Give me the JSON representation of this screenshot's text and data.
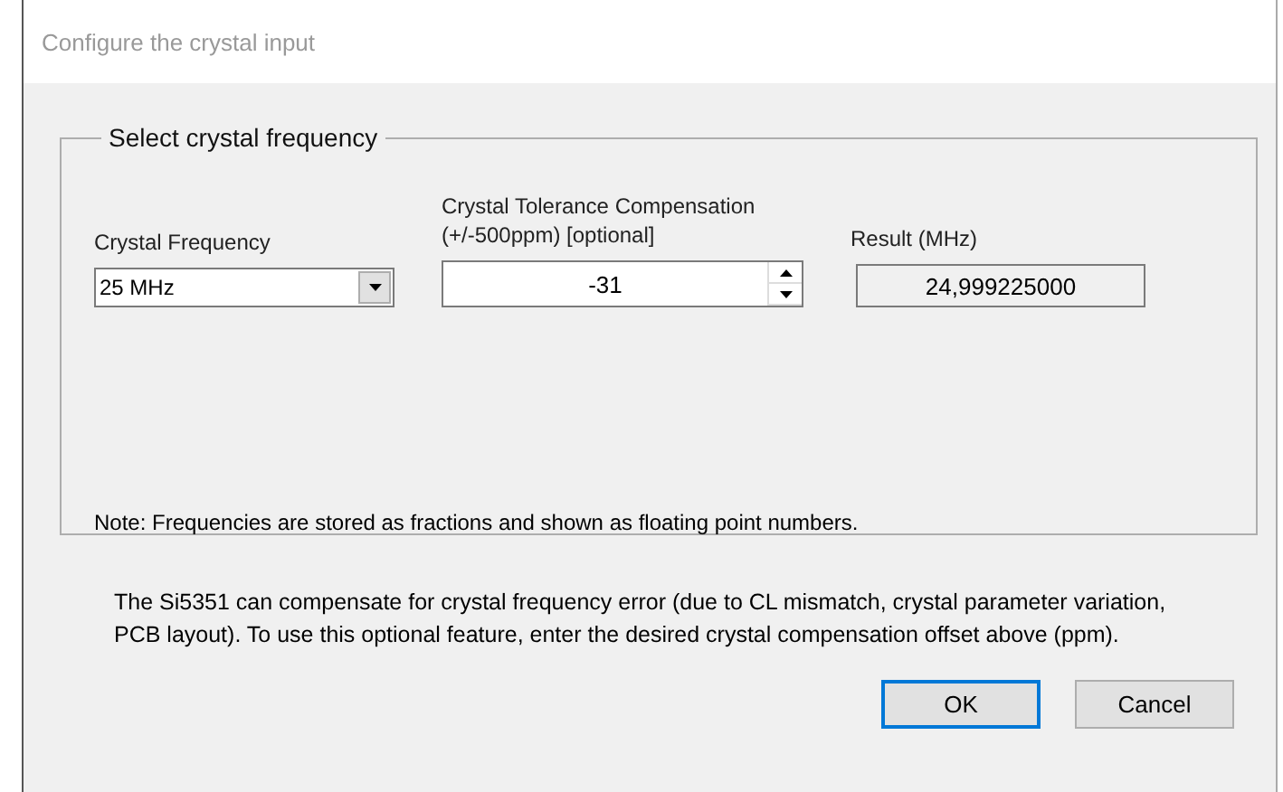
{
  "window": {
    "title": "Configure the crystal input"
  },
  "group": {
    "title": "Select crystal frequency",
    "frequency": {
      "label": "Crystal Frequency",
      "value": "25 MHz"
    },
    "tolerance": {
      "label_lines": [
        "Crystal Tolerance Compensation",
        "(+/-500ppm) [optional]"
      ],
      "value": "-31"
    },
    "result": {
      "label": "Result (MHz)",
      "value": "24,999225000"
    },
    "note": "Note: Frequencies are stored as fractions and shown as floating point numbers."
  },
  "description": "The Si5351 can compensate for crystal frequency error (due to CL mismatch, crystal parameter variation, PCB layout). To use this optional feature, enter the desired crystal compensation offset above (ppm).",
  "buttons": [
    {
      "label": "OK",
      "default": true
    },
    {
      "label": "Cancel",
      "default": false
    }
  ]
}
